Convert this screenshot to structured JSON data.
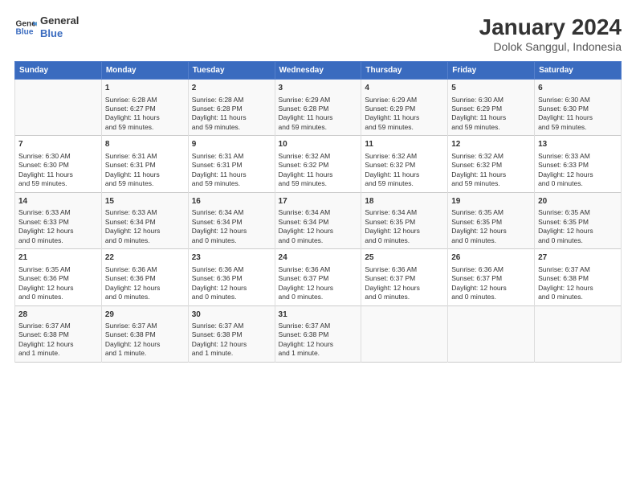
{
  "logo": {
    "line1": "General",
    "line2": "Blue"
  },
  "title": "January 2024",
  "subtitle": "Dolok Sanggul, Indonesia",
  "header_days": [
    "Sunday",
    "Monday",
    "Tuesday",
    "Wednesday",
    "Thursday",
    "Friday",
    "Saturday"
  ],
  "weeks": [
    [
      {
        "day": "",
        "info": ""
      },
      {
        "day": "1",
        "info": "Sunrise: 6:28 AM\nSunset: 6:27 PM\nDaylight: 11 hours\nand 59 minutes."
      },
      {
        "day": "2",
        "info": "Sunrise: 6:28 AM\nSunset: 6:28 PM\nDaylight: 11 hours\nand 59 minutes."
      },
      {
        "day": "3",
        "info": "Sunrise: 6:29 AM\nSunset: 6:28 PM\nDaylight: 11 hours\nand 59 minutes."
      },
      {
        "day": "4",
        "info": "Sunrise: 6:29 AM\nSunset: 6:29 PM\nDaylight: 11 hours\nand 59 minutes."
      },
      {
        "day": "5",
        "info": "Sunrise: 6:30 AM\nSunset: 6:29 PM\nDaylight: 11 hours\nand 59 minutes."
      },
      {
        "day": "6",
        "info": "Sunrise: 6:30 AM\nSunset: 6:30 PM\nDaylight: 11 hours\nand 59 minutes."
      }
    ],
    [
      {
        "day": "7",
        "info": "Sunrise: 6:30 AM\nSunset: 6:30 PM\nDaylight: 11 hours\nand 59 minutes."
      },
      {
        "day": "8",
        "info": "Sunrise: 6:31 AM\nSunset: 6:31 PM\nDaylight: 11 hours\nand 59 minutes."
      },
      {
        "day": "9",
        "info": "Sunrise: 6:31 AM\nSunset: 6:31 PM\nDaylight: 11 hours\nand 59 minutes."
      },
      {
        "day": "10",
        "info": "Sunrise: 6:32 AM\nSunset: 6:32 PM\nDaylight: 11 hours\nand 59 minutes."
      },
      {
        "day": "11",
        "info": "Sunrise: 6:32 AM\nSunset: 6:32 PM\nDaylight: 11 hours\nand 59 minutes."
      },
      {
        "day": "12",
        "info": "Sunrise: 6:32 AM\nSunset: 6:32 PM\nDaylight: 11 hours\nand 59 minutes."
      },
      {
        "day": "13",
        "info": "Sunrise: 6:33 AM\nSunset: 6:33 PM\nDaylight: 12 hours\nand 0 minutes."
      }
    ],
    [
      {
        "day": "14",
        "info": "Sunrise: 6:33 AM\nSunset: 6:33 PM\nDaylight: 12 hours\nand 0 minutes."
      },
      {
        "day": "15",
        "info": "Sunrise: 6:33 AM\nSunset: 6:34 PM\nDaylight: 12 hours\nand 0 minutes."
      },
      {
        "day": "16",
        "info": "Sunrise: 6:34 AM\nSunset: 6:34 PM\nDaylight: 12 hours\nand 0 minutes."
      },
      {
        "day": "17",
        "info": "Sunrise: 6:34 AM\nSunset: 6:34 PM\nDaylight: 12 hours\nand 0 minutes."
      },
      {
        "day": "18",
        "info": "Sunrise: 6:34 AM\nSunset: 6:35 PM\nDaylight: 12 hours\nand 0 minutes."
      },
      {
        "day": "19",
        "info": "Sunrise: 6:35 AM\nSunset: 6:35 PM\nDaylight: 12 hours\nand 0 minutes."
      },
      {
        "day": "20",
        "info": "Sunrise: 6:35 AM\nSunset: 6:35 PM\nDaylight: 12 hours\nand 0 minutes."
      }
    ],
    [
      {
        "day": "21",
        "info": "Sunrise: 6:35 AM\nSunset: 6:36 PM\nDaylight: 12 hours\nand 0 minutes."
      },
      {
        "day": "22",
        "info": "Sunrise: 6:36 AM\nSunset: 6:36 PM\nDaylight: 12 hours\nand 0 minutes."
      },
      {
        "day": "23",
        "info": "Sunrise: 6:36 AM\nSunset: 6:36 PM\nDaylight: 12 hours\nand 0 minutes."
      },
      {
        "day": "24",
        "info": "Sunrise: 6:36 AM\nSunset: 6:37 PM\nDaylight: 12 hours\nand 0 minutes."
      },
      {
        "day": "25",
        "info": "Sunrise: 6:36 AM\nSunset: 6:37 PM\nDaylight: 12 hours\nand 0 minutes."
      },
      {
        "day": "26",
        "info": "Sunrise: 6:36 AM\nSunset: 6:37 PM\nDaylight: 12 hours\nand 0 minutes."
      },
      {
        "day": "27",
        "info": "Sunrise: 6:37 AM\nSunset: 6:38 PM\nDaylight: 12 hours\nand 0 minutes."
      }
    ],
    [
      {
        "day": "28",
        "info": "Sunrise: 6:37 AM\nSunset: 6:38 PM\nDaylight: 12 hours\nand 1 minute."
      },
      {
        "day": "29",
        "info": "Sunrise: 6:37 AM\nSunset: 6:38 PM\nDaylight: 12 hours\nand 1 minute."
      },
      {
        "day": "30",
        "info": "Sunrise: 6:37 AM\nSunset: 6:38 PM\nDaylight: 12 hours\nand 1 minute."
      },
      {
        "day": "31",
        "info": "Sunrise: 6:37 AM\nSunset: 6:38 PM\nDaylight: 12 hours\nand 1 minute."
      },
      {
        "day": "",
        "info": ""
      },
      {
        "day": "",
        "info": ""
      },
      {
        "day": "",
        "info": ""
      }
    ]
  ]
}
